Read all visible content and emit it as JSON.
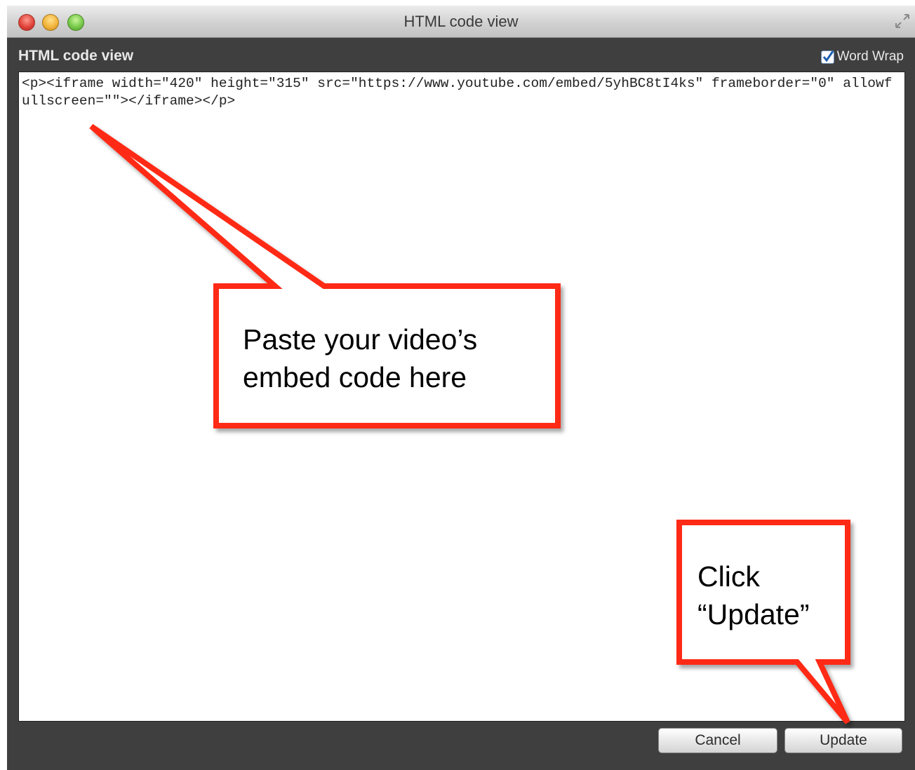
{
  "window": {
    "title": "HTML code view"
  },
  "dialog": {
    "header": "HTML code view",
    "word_wrap_label": "Word Wrap",
    "word_wrap_checked": true
  },
  "editor": {
    "code": "<p><iframe width=\"420\" height=\"315\" src=\"https://www.youtube.com/embed/5yhBC8tI4ks\" frameborder=\"0\" allowfullscreen=\"\"></iframe></p>"
  },
  "buttons": {
    "cancel_label": "Cancel",
    "update_label": "Update"
  },
  "annotations": {
    "paste_note_line1": "Paste your video’s",
    "paste_note_line2": "embed code here",
    "click_note_line1": "Click",
    "click_note_line2": "“Update”",
    "callout_color": "#ff2a12"
  }
}
